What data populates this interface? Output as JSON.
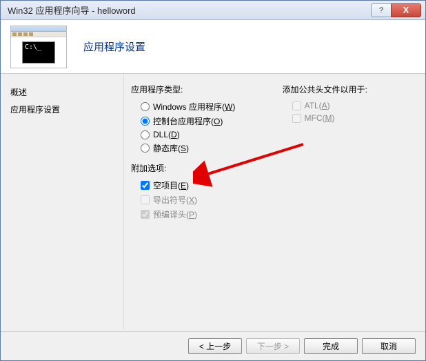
{
  "titlebar": {
    "text": "Win32 应用程序向导 - helloword",
    "help": "?",
    "close": "X"
  },
  "banner": {
    "title": "应用程序设置",
    "cmd_prompt": "C:\\_"
  },
  "sidebar": {
    "items": [
      {
        "label": "概述"
      },
      {
        "label": "应用程序设置"
      }
    ]
  },
  "content": {
    "app_type_label": "应用程序类型:",
    "app_type": {
      "windows": {
        "text": "Windows 应用程序(",
        "mn": "W",
        "tail": ")"
      },
      "console": {
        "text": "控制台应用程序(",
        "mn": "O",
        "tail": ")"
      },
      "dll": {
        "text": "DLL(",
        "mn": "D",
        "tail": ")"
      },
      "static": {
        "text": "静态库(",
        "mn": "S",
        "tail": ")"
      }
    },
    "extra_label": "附加选项:",
    "extra": {
      "empty": {
        "text": "空项目(",
        "mn": "E",
        "tail": ")"
      },
      "export": {
        "text": "导出符号(",
        "mn": "X",
        "tail": ")"
      },
      "pch": {
        "text": "预编译头(",
        "mn": "P",
        "tail": ")"
      }
    },
    "headers_label": "添加公共头文件以用于:",
    "headers": {
      "atl": {
        "text": "ATL(",
        "mn": "A",
        "tail": ")"
      },
      "mfc": {
        "text": "MFC(",
        "mn": "M",
        "tail": ")"
      }
    }
  },
  "footer": {
    "prev": "< 上一步",
    "next": "下一步 >",
    "finish": "完成",
    "cancel": "取消"
  }
}
